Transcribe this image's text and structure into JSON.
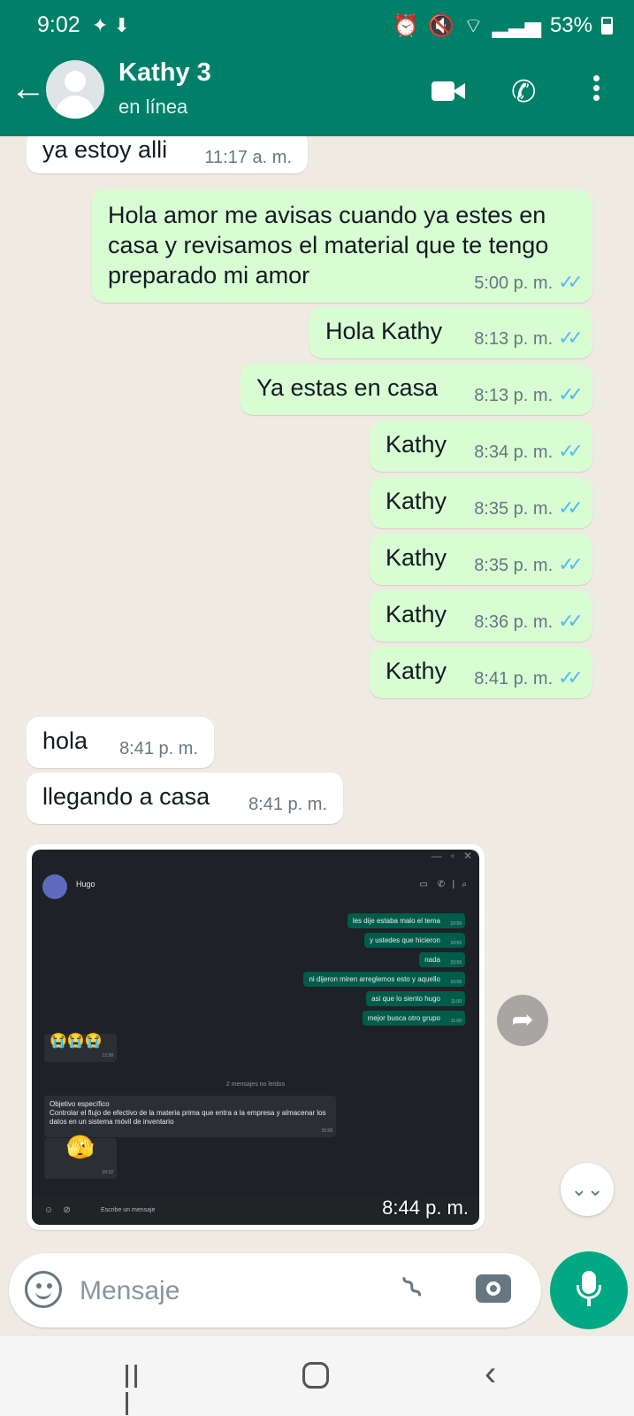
{
  "status_bar": {
    "time": "9:02",
    "battery": "53%"
  },
  "header": {
    "contact_name": "Kathy 3",
    "contact_status": "en línea"
  },
  "messages": [
    {
      "dir": "in",
      "text": "ya estoy alli",
      "time": "11:17 a. m."
    },
    {
      "dir": "out",
      "text": "Hola amor me avisas cuando ya estes en casa y revisamos el material que te tengo preparado mi amor",
      "time": "5:00 p. m."
    },
    {
      "dir": "out",
      "text": "Hola Kathy",
      "time": "8:13 p. m."
    },
    {
      "dir": "out",
      "text": "Ya estas en casa",
      "time": "8:13 p. m."
    },
    {
      "dir": "out",
      "text": "Kathy",
      "time": "8:34 p. m."
    },
    {
      "dir": "out",
      "text": "Kathy",
      "time": "8:35 p. m."
    },
    {
      "dir": "out",
      "text": "Kathy",
      "time": "8:35 p. m."
    },
    {
      "dir": "out",
      "text": "Kathy",
      "time": "8:36 p. m."
    },
    {
      "dir": "out",
      "text": "Kathy",
      "time": "8:41 p. m."
    },
    {
      "dir": "in",
      "text": "hola",
      "time": "8:41 p. m."
    },
    {
      "dir": "in",
      "text": "llegando a casa",
      "time": "8:41 p. m."
    }
  ],
  "image_message": {
    "time": "8:44 p. m.",
    "screenshot": {
      "contact": "Hugo",
      "out_messages": [
        {
          "text": "les dije estaba malo el tema",
          "time": "10:59"
        },
        {
          "text": "y ustedes que hicieron",
          "time": "10:59"
        },
        {
          "text": "nada",
          "time": "10:59"
        },
        {
          "text": "ni dijeron miren arreglemos esto y aquello",
          "time": "10:59"
        },
        {
          "text": "asi que lo siento hugo",
          "time": "11:00"
        },
        {
          "text": "mejor busca otro grupo",
          "time": "11:00"
        }
      ],
      "emoji_message": {
        "text": "😭😭😭",
        "time": "12:38"
      },
      "unread_label": "2 mensajes no leídos",
      "objective_message": {
        "title": "Objetivo específico",
        "body": "Controlar el flujo de efectivo de la materia prima que entra a la empresa y almacenar los datos en un sistema móvil de inventario",
        "time": "15:58"
      },
      "emoji2": {
        "text": "🫣",
        "time": "20:32"
      },
      "composer_placeholder": "Escribe un mensaje"
    }
  },
  "composer": {
    "placeholder": "Mensaje"
  },
  "icons": [
    "back-arrow-icon",
    "video-call-icon",
    "phone-icon",
    "more-options-icon",
    "forward-icon",
    "scroll-down-icon",
    "emoji-icon",
    "attach-icon",
    "camera-icon",
    "mic-icon"
  ],
  "colors": {
    "header": "#008069",
    "outgoing_bubble": "#d9fdd3",
    "incoming_bubble": "#ffffff",
    "read_ticks": "#53bdeb",
    "accent": "#00a884"
  }
}
